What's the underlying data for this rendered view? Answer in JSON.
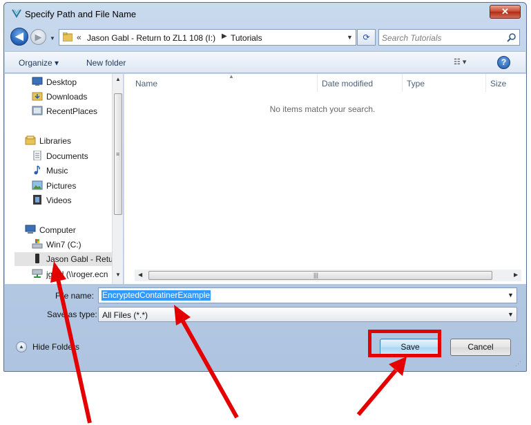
{
  "window": {
    "title": "Specify Path and File Name",
    "close_glyph": "✕"
  },
  "navbar": {
    "back_glyph": "◀",
    "forward_glyph": "▶",
    "address": {
      "overflow_glyph": "«",
      "segments": [
        "Jason Gabl - Return to ZL1 108 (I:)",
        "Tutorials"
      ],
      "separator_glyph": "▶"
    },
    "refresh_glyph": "⟳",
    "search": {
      "placeholder": "Search Tutorials"
    }
  },
  "toolbar": {
    "organize_label": "Organize ▾",
    "new_folder_label": "New folder",
    "views_glyph": "☷ ▾",
    "help_glyph": "?"
  },
  "nav_pane": {
    "items": [
      {
        "label": "Desktop",
        "icon": "desktop-icon"
      },
      {
        "label": "Downloads",
        "icon": "downloads-folder-icon"
      },
      {
        "label": "RecentPlaces",
        "icon": "recent-places-icon"
      },
      {
        "label": "Libraries",
        "icon": "libraries-icon"
      },
      {
        "label": "Documents",
        "icon": "documents-icon"
      },
      {
        "label": "Music",
        "icon": "music-icon"
      },
      {
        "label": "Pictures",
        "icon": "pictures-icon"
      },
      {
        "label": "Videos",
        "icon": "videos-icon"
      },
      {
        "label": "Computer",
        "icon": "computer-icon"
      },
      {
        "label": "Win7 (C:)",
        "icon": "windows-drive-icon"
      },
      {
        "label": "Jason Gabl - Retu",
        "icon": "usb-drive-icon",
        "selected": true
      },
      {
        "label": "jgabl (\\\\roger.ecn",
        "icon": "network-drive-icon"
      }
    ]
  },
  "file_list": {
    "columns": [
      "Name",
      "Date modified",
      "Type",
      "Size"
    ],
    "empty_message": "No items match your search."
  },
  "form": {
    "file_name_label": "File name:",
    "file_name_value": "EncryptedContatinerExample",
    "save_type_label": "Save as type:",
    "save_type_value": "All Files (*.*)"
  },
  "footer": {
    "hide_folders_label": "Hide Folders",
    "save_label": "Save",
    "cancel_label": "Cancel"
  },
  "colors": {
    "annotation": "#e40000",
    "selection": "#3399ff",
    "dialog_frame": "#b9cde6"
  }
}
